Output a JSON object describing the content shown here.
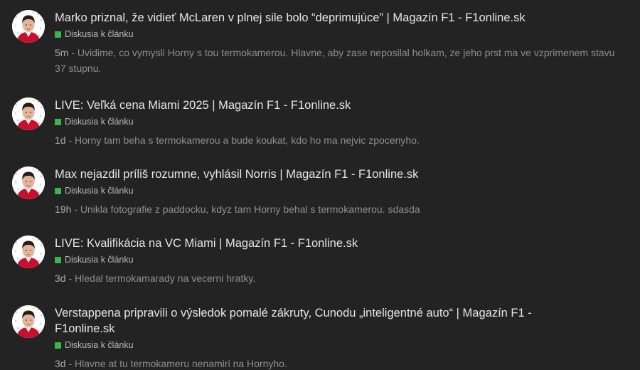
{
  "items": [
    {
      "title": "Marko priznal, že vidieť McLaren v plnej sile bolo “deprimujúce” | Magazín F1 - F1online.sk",
      "tag": "Diskusia k článku",
      "time": "5m",
      "separator": " - ",
      "comment": "Uvidime, co vymysli Horny s tou termokamerou. Hlavne, aby zase neposilal holkam, ze jeho prst ma ve vzprimenem stavu 37 stupnu."
    },
    {
      "title": "LIVE: Veľká cena Miami 2025 | Magazín F1 - F1online.sk",
      "tag": "Diskusia k článku",
      "time": "1d",
      "separator": " - ",
      "comment": "Horny tam beha s termokamerou a bude koukat, kdo ho ma nejvic zpocenyho."
    },
    {
      "title": "Max nejazdil príliš rozumne, vyhlásil Norris | Magazín F1 - F1online.sk",
      "tag": "Diskusia k článku",
      "time": "19h",
      "separator": " - ",
      "comment": "Unikla fotografie z paddocku, kdyz tam Horny behal s termokamerou. sdasda"
    },
    {
      "title": "LIVE: Kvalifikácia na VC Miami | Magazín F1 - F1online.sk",
      "tag": "Diskusia k článku",
      "time": "3d",
      "separator": " - ",
      "comment": "Hledal termokamarady na vecerni hratky."
    },
    {
      "title": "Verstappena pripravili o výsledok pomalé zákruty, Cunodu „inteligentné auto“ | Magazín F1 - F1online.sk",
      "tag": "Diskusia k článku",
      "time": "3d",
      "separator": " - ",
      "comment": "Hlavne at tu termokameru nenamiri na Hornyho."
    }
  ],
  "colors": {
    "background": "#232323",
    "title": "#e6e6e6",
    "tag_square": "#39b54a",
    "comment": "#8f8f8f"
  },
  "icons": {
    "avatar": "user-avatar-icon",
    "tag": "green-square-icon"
  }
}
